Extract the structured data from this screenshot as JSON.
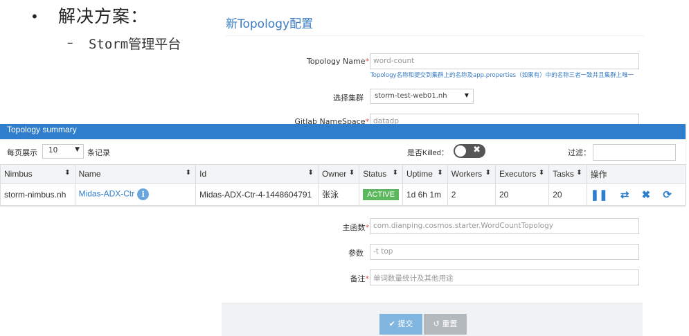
{
  "slide": {
    "bullet_dot": "•",
    "title": "解决方案：",
    "sub_dash": "–",
    "subtitle": "Storm管理平台"
  },
  "form": {
    "title": "新Topology配置",
    "topology_name": {
      "label": "Topology Name",
      "placeholder": "word-count",
      "help": "Topology名称和提交到集群上的名称及app.properties（如果有）中的名称三者一致并且集群上唯一"
    },
    "cluster": {
      "label": "选择集群",
      "value": "storm-test-web01.nh"
    },
    "gitlab_namespace": {
      "label": "Gitlab NameSpace",
      "placeholder": "datadp"
    },
    "main_class": {
      "label": "主函数",
      "placeholder": "com.dianping.cosmos.starter.WordCountTopology"
    },
    "params": {
      "label": "参数",
      "placeholder": "-t top"
    },
    "remark": {
      "label": "备注",
      "placeholder": "单词数量统计及其他用途"
    },
    "required_mark": "*",
    "submit_label": "✔ 提交",
    "reset_label": "↺ 重置"
  },
  "summary": {
    "header": "Topology summary",
    "page_size_label": "每页展示",
    "page_size_value": "10",
    "entries_label": "条记录",
    "killed_label": "是否Killed：",
    "filter_label": "过滤：",
    "columns": [
      "Nimbus",
      "Name",
      "Id",
      "Owner",
      "Status",
      "Uptime",
      "Workers",
      "Executors",
      "Tasks",
      "操作"
    ],
    "rows": [
      {
        "nimbus": "storm-nimbus.nh",
        "name": "Midas-ADX-Ctr",
        "id": "Midas-ADX-Ctr-4-1448604791",
        "owner": "张泳",
        "status": "ACTIVE",
        "uptime": "1d 6h 1m",
        "workers": "2",
        "executors": "20",
        "tasks": "20"
      }
    ],
    "sort_icon": "⬍",
    "colors": {
      "header_bg": "#2f7ecd",
      "status_active": "#5cb85c",
      "link": "#2f7ecd"
    }
  }
}
